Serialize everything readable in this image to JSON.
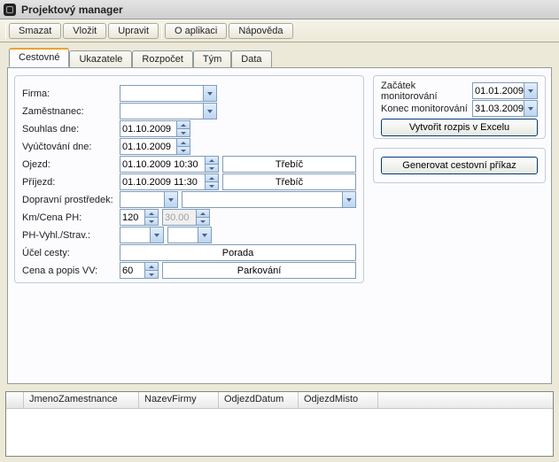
{
  "window": {
    "title": "Projektový manager"
  },
  "menu": {
    "smazat": "Smazat",
    "vlozit": "Vložit",
    "upravit": "Upravit",
    "o_aplikaci": "O aplikaci",
    "napoveda": "Nápověda"
  },
  "tabs": {
    "cestovne": "Cestovné",
    "ukazatele": "Ukazatele",
    "rozpocet": "Rozpočet",
    "tym": "Tým",
    "data": "Data"
  },
  "form": {
    "firma_label": "Firma:",
    "firma_value": "",
    "zamestnanec_label": "Zaměstnanec:",
    "zamestnanec_value": "",
    "souhlas_label": "Souhlas dne:",
    "souhlas_value": "01.10.2009",
    "vyuct_label": "Vyúčtování dne:",
    "vyuct_value": "01.10.2009",
    "ojezd_label": "Ojezd:",
    "ojezd_value": "01.10.2009 10:30",
    "ojezd_place": "Třebíč",
    "prijezd_label": "Příjezd:",
    "prijezd_value": "01.10.2009 11:30",
    "prijezd_place": "Třebíč",
    "dopr_label": "Dopravní prostředek:",
    "dopr_value": "",
    "dopr_detail": "",
    "km_label": "Km/Cena PH:",
    "km_value": "120",
    "cena_ph": "30.00",
    "phvyhl_label": "PH-Vyhl./Strav.:",
    "phvyhl_value": "",
    "strav_value": "",
    "ucel_label": "Účel cesty:",
    "ucel_value": "Porada",
    "cenavv_label": "Cena a popis VV:",
    "cenavv_value": "60",
    "popisvv_value": "Parkování"
  },
  "monitoring": {
    "start_label": "Začátek monitorování",
    "start_value": "01.01.2009",
    "end_label": "Konec monitorování",
    "end_value": "31.03.2009",
    "create_excel": "Vytvořit rozpis v Excelu",
    "generate_order": "Generovat cestovní příkaz"
  },
  "grid": {
    "columns": [
      "JmenoZamestnance",
      "NazevFirmy",
      "OdjezdDatum",
      "OdjezdMisto"
    ]
  }
}
